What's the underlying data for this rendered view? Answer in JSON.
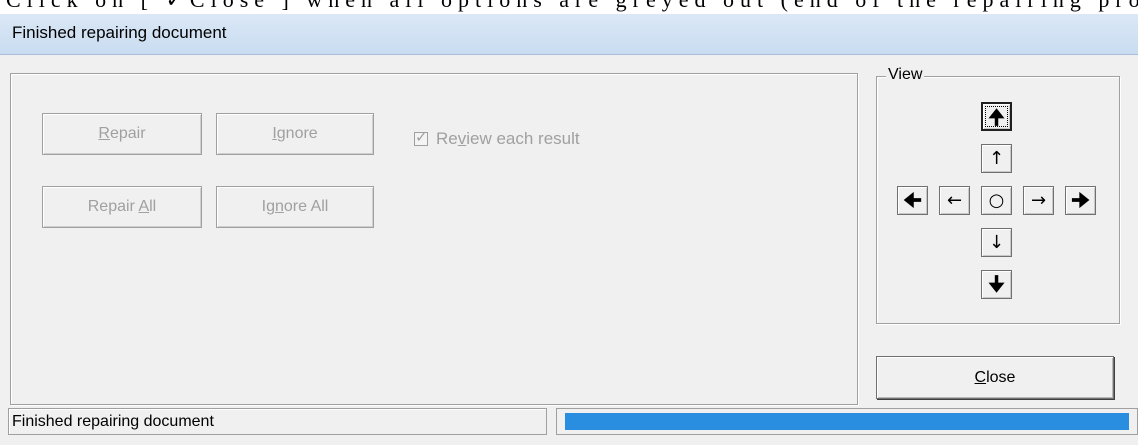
{
  "doc_caption": "Click on [ ✓Close ] when all options are greyed out (end of the repairing process)",
  "window": {
    "title": "Finished repairing document"
  },
  "buttons": {
    "repair": {
      "mnemonic": "R",
      "rest": "epair"
    },
    "ignore": {
      "mnemonic": "I",
      "rest": "gnore"
    },
    "repair_all": {
      "pre": "Repair ",
      "mnemonic": "A",
      "rest": "ll"
    },
    "ignore_all": {
      "pre": "Ig",
      "mnemonic": "n",
      "rest": "ore All"
    }
  },
  "review_checkbox": {
    "pre": "Re",
    "mnemonic": "v",
    "rest": "iew each result",
    "checked": true,
    "check_glyph": "✓"
  },
  "view": {
    "label": "View",
    "arrows": {
      "top_bold": "🠉",
      "up": "↑",
      "left_bold": "🠈",
      "left": "←",
      "center": "○",
      "right": "→",
      "right_bold": "🠊",
      "down": "↓",
      "bottom_bold": "🠋"
    }
  },
  "close_button": {
    "mnemonic": "C",
    "rest": "lose"
  },
  "status": {
    "text": "Finished repairing document",
    "progress": 1.0
  },
  "colors": {
    "progress": "#2a8ee0",
    "disabled_text": "#a0a0a0"
  }
}
